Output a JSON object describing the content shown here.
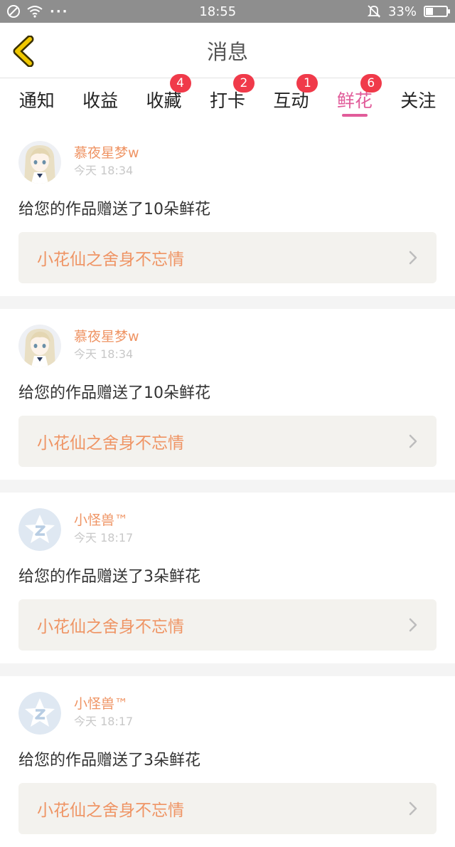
{
  "status": {
    "time": "18:55",
    "battery": "33%",
    "battery_level": 0.33
  },
  "header": {
    "title": "消息"
  },
  "tabs": [
    {
      "label": "通知",
      "badge": ""
    },
    {
      "label": "收益",
      "badge": ""
    },
    {
      "label": "收藏",
      "badge": "4"
    },
    {
      "label": "打卡",
      "badge": "2"
    },
    {
      "label": "互动",
      "badge": "1"
    },
    {
      "label": "鲜花",
      "badge": "6",
      "active": true
    },
    {
      "label": "关注",
      "badge": ""
    }
  ],
  "messages": [
    {
      "user": "慕夜星梦w",
      "time": "今天 18:34",
      "text": "给您的作品赠送了10朵鲜花",
      "work": "小花仙之舍身不忘情",
      "avatar": "anime-avatar"
    },
    {
      "user": "慕夜星梦w",
      "time": "今天 18:34",
      "text": "给您的作品赠送了10朵鲜花",
      "work": "小花仙之舍身不忘情",
      "avatar": "anime-avatar"
    },
    {
      "user": "小怪兽™",
      "time": "今天 18:17",
      "text": "给您的作品赠送了3朵鲜花",
      "work": "小花仙之舍身不忘情",
      "avatar": "qq-avatar"
    },
    {
      "user": "小怪兽™",
      "time": "今天 18:17",
      "text": "给您的作品赠送了3朵鲜花",
      "work": "小花仙之舍身不忘情",
      "avatar": "qq-avatar"
    }
  ],
  "colors": {
    "accent": "#e15c9a",
    "name": "#ef9464",
    "badge": "#f03a4a",
    "back": "#f0c800"
  }
}
